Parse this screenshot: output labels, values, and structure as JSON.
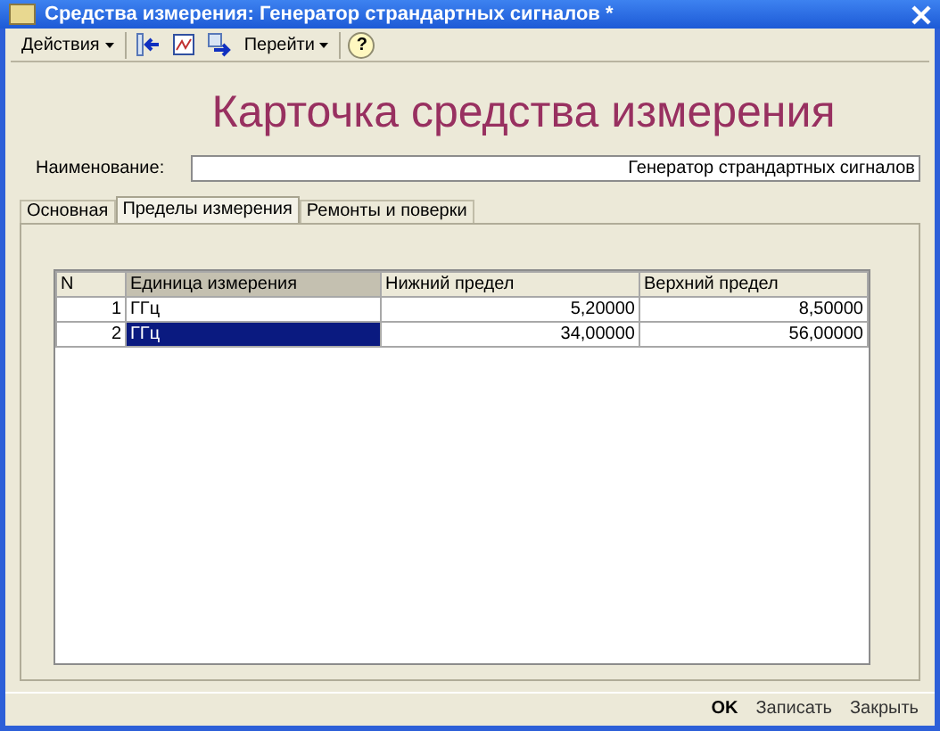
{
  "window": {
    "title": "Средства измерения: Генератор страндартных сигналов *"
  },
  "toolbar": [
    {
      "kind": "menu",
      "label": "Действия"
    },
    {
      "kind": "back"
    },
    {
      "kind": "chart"
    },
    {
      "kind": "switch"
    },
    {
      "kind": "menu",
      "label": "Перейти"
    },
    {
      "kind": "help",
      "label": "?"
    }
  ],
  "heading": "Карточка средства измерения",
  "name_field": {
    "label": "Наименование:",
    "value": "Генератор страндартных сигналов"
  },
  "tabs": [
    {
      "label": "Основная",
      "selected": false
    },
    {
      "label": "Пределы измерения",
      "selected": true
    },
    {
      "label": "Ремонты и поверки",
      "selected": false
    }
  ],
  "table": {
    "columns": [
      {
        "label": "N",
        "selected": false
      },
      {
        "label": "Единица измерения",
        "selected": true
      },
      {
        "label": "Нижний предел",
        "selected": false
      },
      {
        "label": "Верхний предел",
        "selected": false
      }
    ],
    "rows": [
      {
        "cells": [
          "1",
          "ГГц",
          "5,20000",
          "8,50000"
        ],
        "selected": false
      },
      {
        "cells": [
          "2",
          "ГГц",
          "34,00000",
          "56,00000"
        ],
        "selected": true
      }
    ]
  },
  "buttons": [
    {
      "label": "OK",
      "default": true
    },
    {
      "label": "Записать",
      "default": false
    },
    {
      "label": "Закрыть",
      "default": false
    }
  ]
}
